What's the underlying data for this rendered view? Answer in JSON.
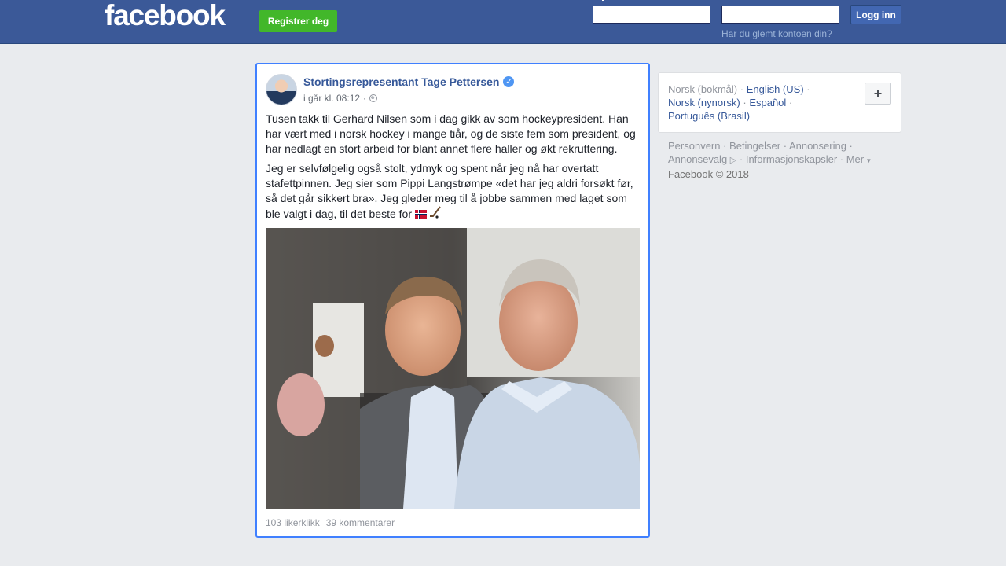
{
  "header": {
    "logo": "facebook",
    "register_label": "Registrer deg",
    "email_value": "",
    "password_value": "",
    "login_label": "Logg inn",
    "forgot_label": "Har du glemt kontoen din?"
  },
  "post": {
    "author": "Stortingsrepresentant Tage Pettersen",
    "verified_icon": "verified-badge-icon",
    "timestamp": "i går kl. 08:12",
    "dot": "·",
    "paragraph1": "Tusen takk til Gerhard Nilsen som i dag gikk av som hockeypresident. Han har vært med i norsk hockey i mange tiår, og de siste fem som president, og har nedlagt en stort arbeid for blant annet flere haller og økt rekruttering.",
    "paragraph2": "Jeg er selvfølgelig også stolt, ydmyk og spent når jeg nå har overtatt stafettpinnen. Jeg sier som Pippi Langstrømpe «det har jeg aldri forsøkt før, så det går sikkert bra». Jeg gleder meg til å jobbe sammen med laget som ble valgt i dag, til det beste for",
    "likes": "103 likerklikk",
    "comments": "39 kommentarer"
  },
  "languages": {
    "current": "Norsk (bokmål)",
    "items": [
      "English (US)",
      "Norsk (nynorsk)",
      "Español",
      "Português (Brasil)"
    ],
    "plus": "+"
  },
  "footer": {
    "links": [
      "Personvern",
      "Betingelser",
      "Annonsering",
      "Annonsevalg",
      "Informasjonskapsler",
      "Mer"
    ],
    "copyright": "Facebook © 2018"
  },
  "colors": {
    "brand": "#3b5998",
    "register": "#42b72a",
    "link": "#365899",
    "focus_border": "#4080ff"
  }
}
